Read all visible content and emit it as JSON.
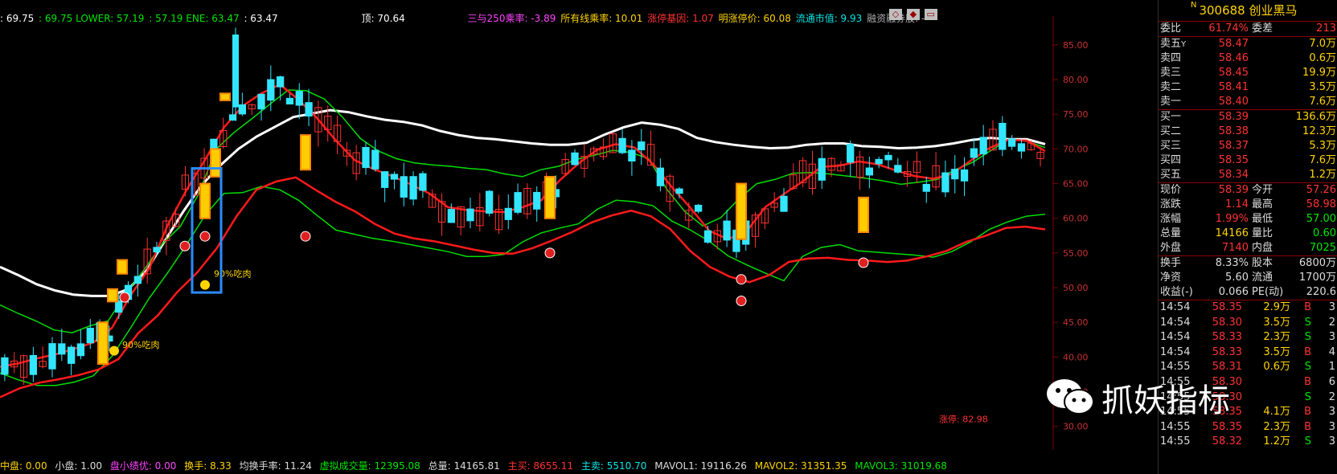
{
  "indicator_bar": {
    "items": [
      {
        "text": ": 69.75",
        "color": "#ffffff"
      },
      {
        "text": ": 69.75 LOWER: 57.19",
        "color": "#00e600"
      },
      {
        "text": ": 57.19 ENE: 63.47",
        "color": "#00e600"
      },
      {
        "text": ": 63.47",
        "color": "#ffffff"
      }
    ],
    "top_label": "顶: 70.64",
    "stats": [
      {
        "text": "三与250乘率: -3.89",
        "color": "#ff44ff"
      },
      {
        "text": "所有线乘率: 10.01",
        "color": "#ffd400"
      },
      {
        "text": "涨停基因: 1.07",
        "color": "#ff3232"
      },
      {
        "text": "明涨停价: 60.08",
        "color": "#ffd400"
      },
      {
        "text": "流通市值: 9.93",
        "color": "#00e6e6"
      },
      {
        "text": "融资融券股: -",
        "color": "#aaaaaa"
      }
    ]
  },
  "panel_controls": [
    "◇",
    "◆",
    "▭"
  ],
  "annotations": {
    "peak_text": "90%吃肉",
    "low_text": "90%吃肉",
    "limit_label": "涨停: 82.98"
  },
  "bottom_bar": [
    {
      "text": "中盘: 0.00",
      "color": "#ffd400"
    },
    {
      "text": "小盘: 1.00",
      "color": "#dddddd"
    },
    {
      "text": "盘小绩优: 0.00",
      "color": "#ff44ff"
    },
    {
      "text": "换手: 8.33",
      "color": "#ffd400"
    },
    {
      "text": "均换手率: 11.24",
      "color": "#dddddd"
    },
    {
      "text": "虚拟成交量: 12395.08",
      "color": "#00e600"
    },
    {
      "text": "总量: 14165.81",
      "color": "#dddddd"
    },
    {
      "text": "主买: 8655.11",
      "color": "#ff3232"
    },
    {
      "text": "主卖: 5510.70",
      "color": "#00e6e6"
    },
    {
      "text": "MAVOL1: 19116.26",
      "color": "#dddddd"
    },
    {
      "text": "MAVOL2: 31351.35",
      "color": "#ffd400"
    },
    {
      "text": "MAVOL3: 31019.68",
      "color": "#00e600"
    }
  ],
  "side_panel": {
    "code": "300688",
    "name": "创业黑马",
    "badge": "N",
    "weibi": {
      "label": "委比",
      "value": "61.74%",
      "label2": "委差",
      "value2": "213"
    },
    "sells": [
      {
        "label": "卖五",
        "mark": "Y",
        "price": "58.47",
        "vol": "7.0万"
      },
      {
        "label": "卖四",
        "price": "58.46",
        "vol": "0.6万"
      },
      {
        "label": "卖三",
        "price": "58.45",
        "vol": "19.9万"
      },
      {
        "label": "卖二",
        "price": "58.41",
        "vol": "3.5万"
      },
      {
        "label": "卖一",
        "price": "58.40",
        "vol": "7.6万"
      }
    ],
    "buys": [
      {
        "label": "买一",
        "price": "58.39",
        "vol": "136.6万"
      },
      {
        "label": "买二",
        "price": "58.38",
        "vol": "12.3万"
      },
      {
        "label": "买三",
        "price": "58.37",
        "vol": "5.3万"
      },
      {
        "label": "买四",
        "price": "58.35",
        "vol": "7.6万"
      },
      {
        "label": "买五",
        "price": "58.34",
        "vol": "1.2万"
      }
    ],
    "quote": [
      {
        "l1": "现价",
        "v1": "58.39",
        "c1": "#ff3232",
        "l2": "今开",
        "v2": "57.26",
        "c2": "#ff3232"
      },
      {
        "l1": "涨跌",
        "v1": "1.14",
        "c1": "#ff3232",
        "l2": "最高",
        "v2": "58.98",
        "c2": "#ff3232"
      },
      {
        "l1": "涨幅",
        "v1": "1.99%",
        "c1": "#ff3232",
        "l2": "最低",
        "v2": "57.00",
        "c2": "#00e600"
      },
      {
        "l1": "总量",
        "v1": "14166",
        "c1": "#ffd400",
        "l2": "量比",
        "v2": "0.60",
        "c2": "#00e600"
      },
      {
        "l1": "外盘",
        "v1": "7140",
        "c1": "#ff3232",
        "l2": "内盘",
        "v2": "7025",
        "c2": "#00e600"
      }
    ],
    "fund": [
      {
        "l1": "换手",
        "v1": "8.33%",
        "l2": "股本",
        "v2": "6800万"
      },
      {
        "l1": "净资",
        "v1": "5.60",
        "l2": "流通",
        "v2": "1700万"
      },
      {
        "l1": "收益(-)",
        "v1": "0.066",
        "l2": "PE(动)",
        "v2": "220.6"
      }
    ],
    "ticks": [
      {
        "time": "14:54",
        "price": "58.35",
        "vol": "2.9万",
        "side": "B",
        "n": "3"
      },
      {
        "time": "14:54",
        "price": "58.30",
        "vol": "3.5万",
        "side": "S",
        "n": "2"
      },
      {
        "time": "14:54",
        "price": "58.33",
        "vol": "2.3万",
        "side": "S",
        "n": "3"
      },
      {
        "time": "14:54",
        "price": "58.33",
        "vol": "3.5万",
        "side": "B",
        "n": "4"
      },
      {
        "time": "14:55",
        "price": "58.31",
        "vol": "0.6万",
        "side": "S",
        "n": "1"
      },
      {
        "time": "14:55",
        "price": "58.30",
        "vol": "",
        "side": "B",
        "n": "6"
      },
      {
        "time": "14:55",
        "price": "58.30",
        "vol": "",
        "side": "S",
        "n": "2"
      },
      {
        "time": "14:55",
        "price": "58.35",
        "vol": "4.1万",
        "side": "B",
        "n": "3"
      },
      {
        "time": "14:55",
        "price": "58.35",
        "vol": "2.3万",
        "side": "B",
        "n": "3"
      },
      {
        "time": "14:55",
        "price": "58.32",
        "vol": "1.2万",
        "side": "S",
        "n": "3"
      }
    ]
  },
  "watermark": "抓妖指标",
  "chart_data": {
    "type": "candlestick",
    "y_ticks": [
      "85.00",
      "80.00",
      "75.00",
      "70.00",
      "65.00",
      "60.00",
      "55.00",
      "50.00",
      "45.00",
      "40.00",
      "35.00",
      "30.00"
    ],
    "ylim": [
      28,
      88
    ],
    "white_line": [
      53,
      51.8,
      50.5,
      49.6,
      49,
      48.8,
      48.8,
      49.8,
      52.5,
      56.8,
      61,
      64.8,
      67.6,
      70,
      71.8,
      73.2,
      74.6,
      75.1,
      75.6,
      75.3,
      74.7,
      74.2,
      73.9,
      73.4,
      72.6,
      72,
      71.6,
      71.4,
      71.1,
      70.8,
      70.6,
      70.6,
      70.9,
      72.1,
      73.1,
      73.8,
      73.5,
      72.9,
      71.6,
      71,
      70.6,
      70.3,
      70.1,
      70.2,
      70.6,
      70.8,
      70.8,
      70.4,
      70.3,
      70.1,
      70.2,
      70.4,
      70.8,
      71.3,
      71.6,
      71.4,
      71.4,
      70.7
    ],
    "red_line": [
      38.6,
      39.1,
      39.8,
      40.4,
      41.2,
      42.1,
      44.2,
      48.9,
      52.8,
      59.1,
      64.1,
      68.5,
      73.1,
      76.2,
      78,
      79.3,
      77.1,
      74.4,
      71.2,
      68.4,
      67.1,
      66.1,
      64.9,
      63.6,
      61.6,
      61.2,
      61,
      60.9,
      61.6,
      62.6,
      65.5,
      67.9,
      69.9,
      70.7,
      70.2,
      67.8,
      64.5,
      61.5,
      58.2,
      57,
      58.1,
      61.6,
      63.5,
      65.3,
      67.4,
      67.6,
      68.2,
      67.8,
      66.9,
      66.1,
      65.7,
      66.4,
      68.3,
      70.1,
      71.3,
      71.2,
      69.7
    ],
    "green_upper": [
      47.5,
      46.3,
      45.2,
      43.9,
      43.5,
      44.5,
      45.2,
      49.2,
      52.6,
      56.3,
      58.8,
      63.4,
      70,
      72.4,
      74.4,
      76.5,
      78.5,
      78.4,
      77.2,
      74.6,
      71.5,
      69.7,
      68.6,
      68,
      67.7,
      67.5,
      67.2,
      67,
      66.4,
      66,
      67,
      67.5,
      68.5,
      69.1,
      69.8,
      69.5,
      68.6,
      64.2,
      61,
      58.9,
      60.1,
      62.8,
      65,
      65.6,
      66.5,
      66.6,
      66.4,
      66.1,
      65.8,
      65.4,
      64.9,
      65.2,
      65.6,
      67,
      68.1,
      69.8,
      71.4,
      71.1,
      70.2
    ],
    "green_lower": [
      37.7,
      36.7,
      35.9,
      35.9,
      36.4,
      37.3,
      40.1,
      44.2,
      48.5,
      52.2,
      56.2,
      60.5,
      63.6,
      63.7,
      64.6,
      64.1,
      62.6,
      60.4,
      58.3,
      57.7,
      57.1,
      56.7,
      56.2,
      55.7,
      55.2,
      54.5,
      54.5,
      54.8,
      56.6,
      57.9,
      58.6,
      59.2,
      61.3,
      62.6,
      62.4,
      61.8,
      59.6,
      58.3,
      56.7,
      54.6,
      53.3,
      52.1,
      51,
      54.5,
      55.8,
      56.2,
      55.3,
      55.1,
      54.9,
      54.7,
      54.4,
      55.2,
      56.6,
      58.4,
      59.5,
      60.3,
      60.6
    ],
    "red_lower": [
      34.2,
      35.5,
      36.3,
      36.8,
      37.4,
      38.2,
      39.7,
      43.4,
      46,
      49.4,
      52.2,
      55.7,
      60.3,
      64.1,
      65.3,
      65.9,
      64.1,
      62.4,
      61,
      59.2,
      57.8,
      57.1,
      56.7,
      56.1,
      55.5,
      55,
      54.9,
      55.7,
      56.8,
      58,
      59.4,
      60.4,
      61.1,
      60.3,
      58.4,
      55.3,
      53,
      51.6,
      50.8,
      51.8,
      53.7,
      54.2,
      54.3,
      54,
      53.9,
      53.7,
      53.9,
      54.5,
      55.3,
      56.6,
      57.5,
      58.6,
      58.8,
      58.4
    ],
    "candles_count": 110,
    "hollow_index": [
      48,
      176,
      305,
      524,
      671,
      916,
      1071
    ],
    "peak_marker_text": "90%吃肉",
    "limit_price": "82.98"
  }
}
